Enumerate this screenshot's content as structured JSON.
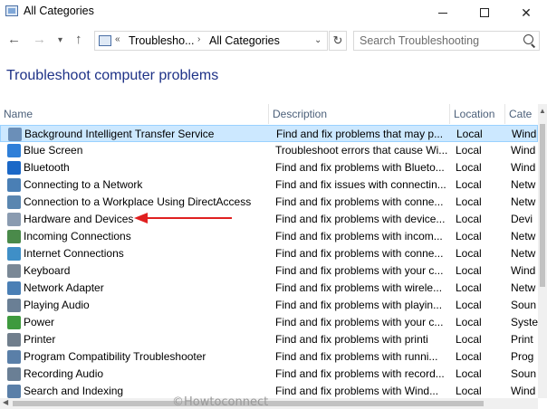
{
  "window": {
    "title": "All Categories",
    "controls": {
      "minimize": "—",
      "maximize": "☐",
      "close": "✕"
    }
  },
  "navigation": {
    "back": "←",
    "forward": "→",
    "recent": "▾",
    "up": "↑",
    "address": {
      "prefix": "«",
      "crumbs": [
        "Troublesho...",
        "All Categories"
      ],
      "separator": "›",
      "dropdown": "⌄",
      "refresh": "↻"
    },
    "search": {
      "placeholder": "Search Troubleshooting",
      "value": ""
    }
  },
  "page_title": "Troubleshoot computer problems",
  "columns": [
    "Name",
    "Description",
    "Location",
    "Cate"
  ],
  "rows": [
    {
      "name": "Background Intelligent Transfer Service",
      "desc": "Find and fix problems that may p...",
      "loc": "Local",
      "cat": "Wind",
      "icon": "bits-icon",
      "color": "#6b8fb8",
      "selected": true
    },
    {
      "name": "Blue Screen",
      "desc": "Troubleshoot errors that cause Wi...",
      "loc": "Local",
      "cat": "Wind",
      "icon": "windows-flag-icon",
      "color": "#2f7fd8"
    },
    {
      "name": "Bluetooth",
      "desc": "Find and fix problems with Blueto...",
      "loc": "Local",
      "cat": "Wind",
      "icon": "bluetooth-icon",
      "color": "#1b68c7"
    },
    {
      "name": "Connecting to a Network",
      "desc": "Find and fix issues with connectin...",
      "loc": "Local",
      "cat": "Netw",
      "icon": "network-icon",
      "color": "#4a7fb5"
    },
    {
      "name": "Connection to a Workplace Using DirectAccess",
      "desc": "Find and fix problems with conne...",
      "loc": "Local",
      "cat": "Netw",
      "icon": "directaccess-icon",
      "color": "#5a86b0"
    },
    {
      "name": "Hardware and Devices",
      "desc": "Find and fix problems with device...",
      "loc": "Local",
      "cat": "Devi",
      "icon": "hardware-icon",
      "color": "#8a9bb0"
    },
    {
      "name": "Incoming Connections",
      "desc": "Find and fix problems with incom...",
      "loc": "Local",
      "cat": "Netw",
      "icon": "incoming-connections-icon",
      "color": "#4a8a4a"
    },
    {
      "name": "Internet Connections",
      "desc": "Find and fix problems with conne...",
      "loc": "Local",
      "cat": "Netw",
      "icon": "internet-icon",
      "color": "#3f8fc7"
    },
    {
      "name": "Keyboard",
      "desc": "Find and fix problems with your c...",
      "loc": "Local",
      "cat": "Wind",
      "icon": "keyboard-icon",
      "color": "#7a8896"
    },
    {
      "name": "Network Adapter",
      "desc": "Find and fix problems with wirele...",
      "loc": "Local",
      "cat": "Netw",
      "icon": "network-adapter-icon",
      "color": "#4a7fb5"
    },
    {
      "name": "Playing Audio",
      "desc": "Find and fix problems with playin...",
      "loc": "Local",
      "cat": "Soun",
      "icon": "speaker-icon",
      "color": "#6a7f95"
    },
    {
      "name": "Power",
      "desc": "Find and fix problems with your c...",
      "loc": "Local",
      "cat": "Syste",
      "icon": "power-icon",
      "color": "#3e9a3e"
    },
    {
      "name": "Printer",
      "desc": "Find and fix problems with printi",
      "loc": "Local",
      "cat": "Print",
      "icon": "printer-icon",
      "color": "#707e8c"
    },
    {
      "name": "Program Compatibility Troubleshooter",
      "desc": "Find and fix problems with runni...",
      "loc": "Local",
      "cat": "Prog",
      "icon": "program-compat-icon",
      "color": "#5a7fa8"
    },
    {
      "name": "Recording Audio",
      "desc": "Find and fix problems with record...",
      "loc": "Local",
      "cat": "Soun",
      "icon": "microphone-icon",
      "color": "#6a7f95"
    },
    {
      "name": "Search and Indexing",
      "desc": "Find and fix problems with Wind...",
      "loc": "Local",
      "cat": "Wind",
      "icon": "search-indexing-icon",
      "color": "#5a7fa8"
    }
  ],
  "watermark": "©Howtoconnect",
  "colors": {
    "title": "#1e3287",
    "header_text": "#4c607a",
    "selection": "#cce8ff",
    "annotation": "#e02020"
  }
}
